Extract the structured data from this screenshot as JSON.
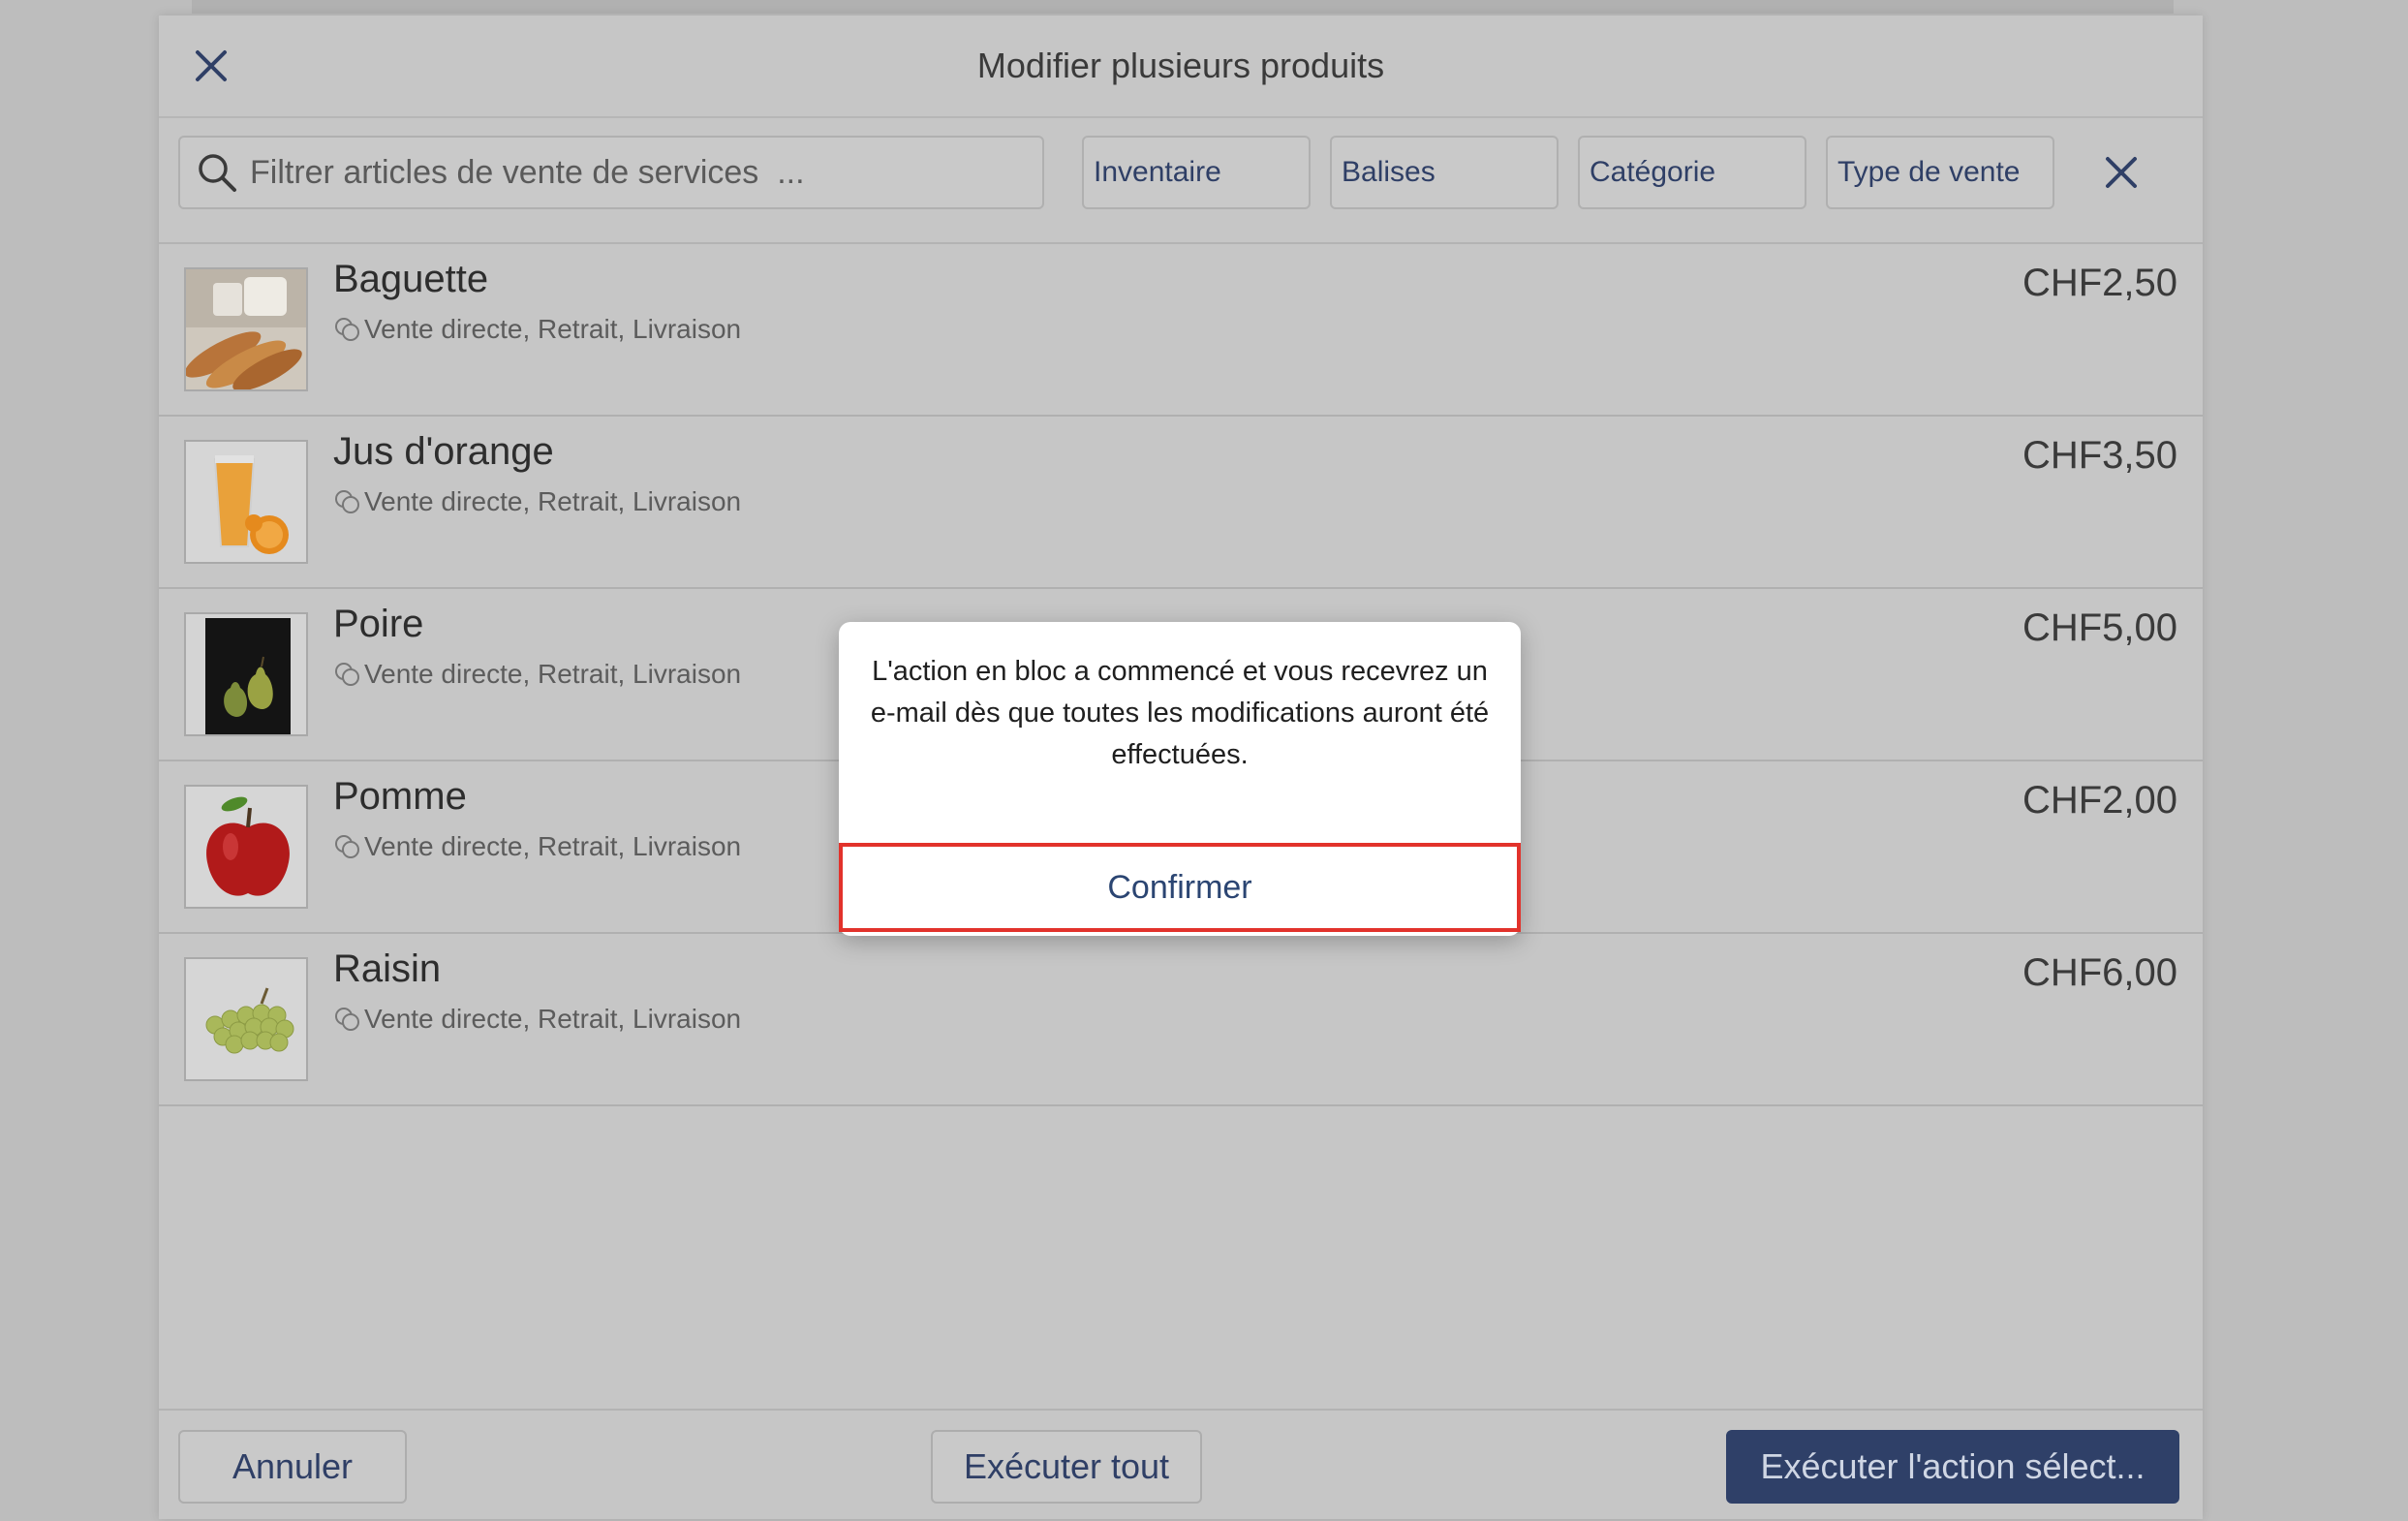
{
  "header": {
    "title": "Modifier plusieurs produits",
    "close_icon": "close-icon"
  },
  "filters": {
    "search_placeholder": "Filtrer articles de vente de services  ...",
    "chips": [
      "Inventaire",
      "Balises",
      "Catégorie",
      "Type de vente"
    ],
    "clear_icon": "close-icon"
  },
  "products": [
    {
      "name": "Baguette",
      "channels": "Vente directe, Retrait, Livraison",
      "price": "CHF2,50",
      "image": "baguette-image"
    },
    {
      "name": "Jus d'orange",
      "channels": "Vente directe, Retrait, Livraison",
      "price": "CHF3,50",
      "image": "orange-juice-image"
    },
    {
      "name": "Poire",
      "channels": "Vente directe, Retrait, Livraison",
      "price": "CHF5,00",
      "image": "pear-image"
    },
    {
      "name": "Pomme",
      "channels": "Vente directe, Retrait, Livraison",
      "price": "CHF2,00",
      "image": "apple-image"
    },
    {
      "name": "Raisin",
      "channels": "Vente directe, Retrait, Livraison",
      "price": "CHF6,00",
      "image": "grapes-image"
    }
  ],
  "footer": {
    "cancel_label": "Annuler",
    "run_all_label": "Exécuter tout",
    "run_selected_label": "Exécuter l'action sélect..."
  },
  "dialog": {
    "message": "L'action en bloc a commencé et vous recevrez un e-mail dès que toutes les modifications auront été effectuées.",
    "confirm_label": "Confirmer"
  },
  "colors": {
    "accent": "#2f4068",
    "highlight": "#e2322b"
  }
}
